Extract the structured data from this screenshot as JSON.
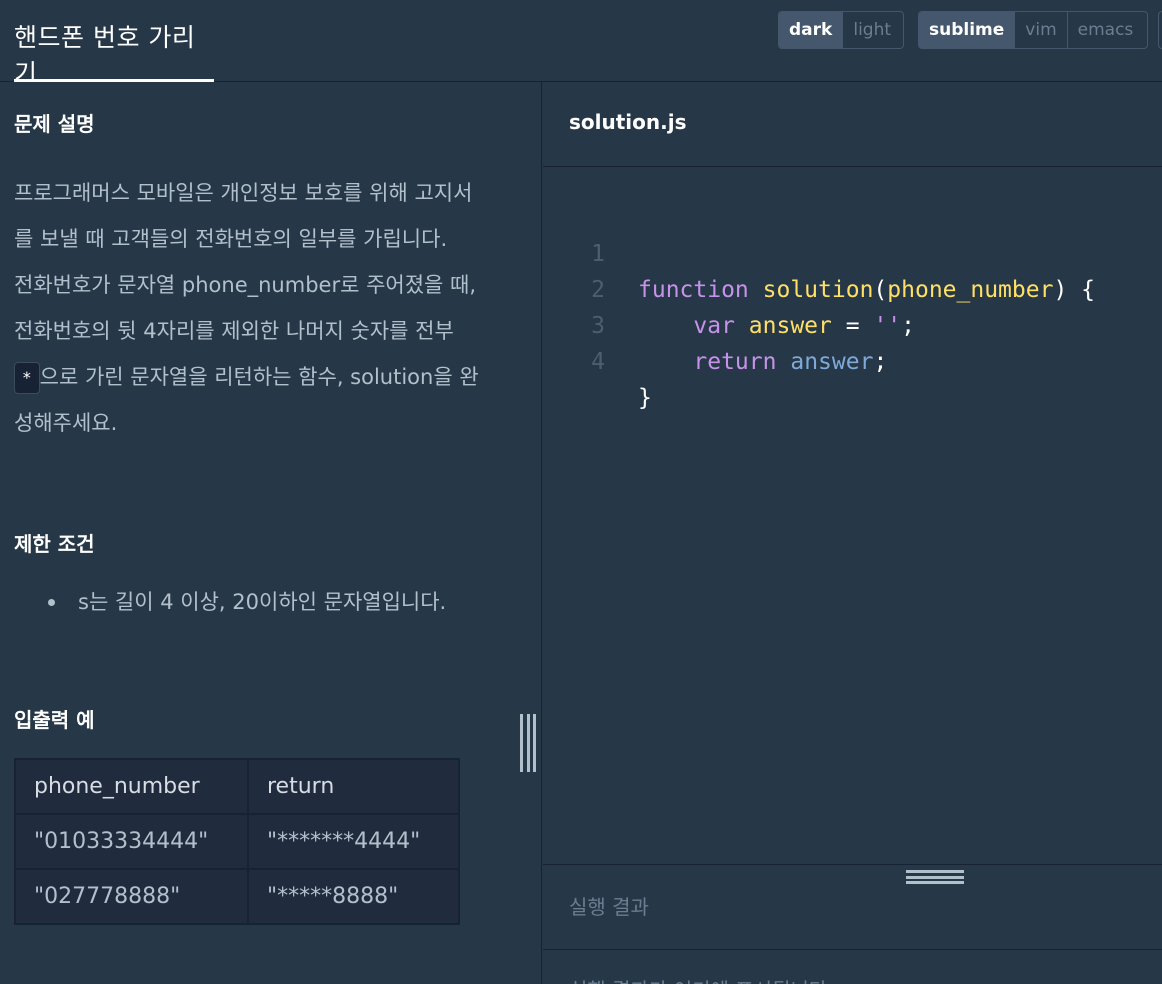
{
  "header": {
    "title": "핸드폰 번호 가리기",
    "theme_options": [
      "dark",
      "light"
    ],
    "theme_selected": "dark",
    "keymap_options": [
      "sublime",
      "vim",
      "emacs"
    ],
    "keymap_selected": "sublime"
  },
  "problem": {
    "description_heading": "문제 설명",
    "description_p1": "프로그래머스 모바일은 개인정보 보호를 위해 고지서를 보낼 때 고객들의 전화번호의 일부를 가립니다.",
    "description_p2_before": "전화번호가 문자열 phone_number로 주어졌을 때, 전화번호의 뒷 4자리를 제외한 나머지 숫자를 전부 ",
    "description_p2_code": "*",
    "description_p2_after": "으로 가린 문자열을 리턴하는 함수, solution을 완성해주세요.",
    "constraints_heading": "제한 조건",
    "constraints": [
      "s는 길이 4 이상, 20이하인 문자열입니다."
    ],
    "io_heading": "입출력 예",
    "io_table": {
      "headers": [
        "phone_number",
        "return"
      ],
      "rows": [
        [
          "\"01033334444\"",
          "\"*******4444\""
        ],
        [
          "\"027778888\"",
          "\"*****8888\""
        ]
      ]
    }
  },
  "editor": {
    "file_name": "solution.js",
    "lines": [
      {
        "num": "1",
        "tokens": {
          "kw": "function",
          "fn": "solution",
          "open": "(",
          "param": "phone_number",
          "close": ") {"
        }
      },
      {
        "num": "2",
        "tokens": {
          "indent": "    ",
          "kw": "var",
          "id": "answer",
          "op": " = ",
          "str": "''",
          "end": ";"
        }
      },
      {
        "num": "3",
        "tokens": {
          "indent": "    ",
          "kw": "return",
          "id": "answer",
          "end": ";"
        }
      },
      {
        "num": "4",
        "tokens": {
          "close": "}"
        }
      }
    ]
  },
  "result": {
    "label": "실행 결과",
    "body": "실행 결과가 여기에 표시됩니다."
  }
}
